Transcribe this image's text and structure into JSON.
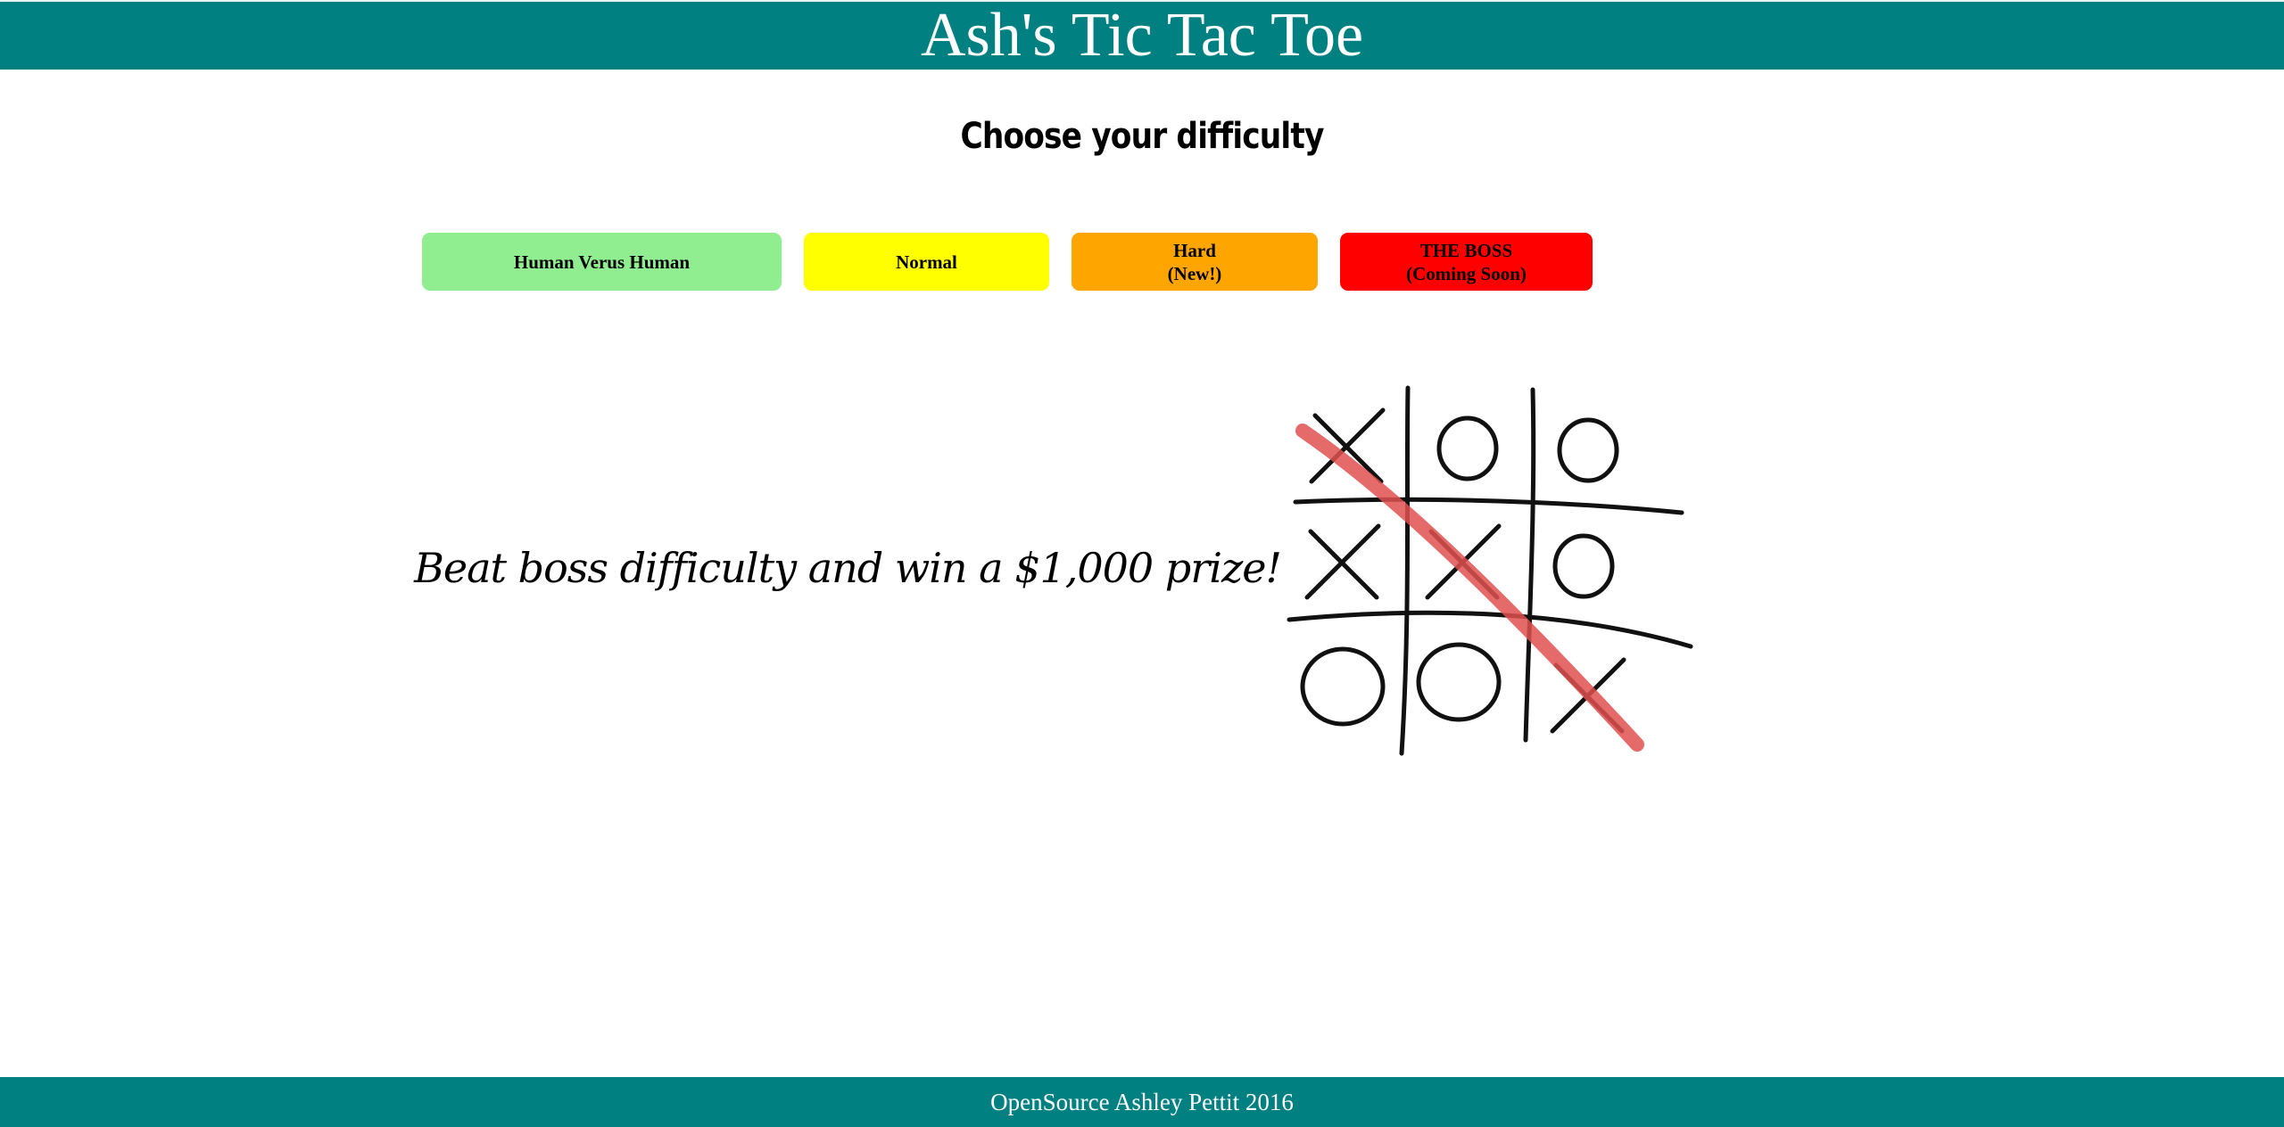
{
  "header": {
    "title": "Ash's Tic Tac Toe"
  },
  "difficulty": {
    "heading": "Choose your difficulty",
    "buttons": [
      {
        "line1": "Human Verus Human",
        "line2": "",
        "color": "#90ee90"
      },
      {
        "line1": "Normal",
        "line2": "",
        "color": "#ffff00"
      },
      {
        "line1": "Hard",
        "line2": "(New!)",
        "color": "#ffa500"
      },
      {
        "line1": "THE BOSS",
        "line2": "(Coming Soon)",
        "color": "#ff0000"
      }
    ]
  },
  "promo": {
    "text": "Beat boss difficulty and win a $1,000 prize!"
  },
  "board": {
    "cells": [
      "X",
      "O",
      "O",
      "X",
      "X",
      "O",
      "O",
      "O",
      "X"
    ],
    "win_line_color": "#e05050",
    "winner": "X"
  },
  "footer": {
    "text": "OpenSource Ashley Pettit 2016"
  },
  "colors": {
    "header_bg": "#008080",
    "footer_bg": "#008080"
  }
}
